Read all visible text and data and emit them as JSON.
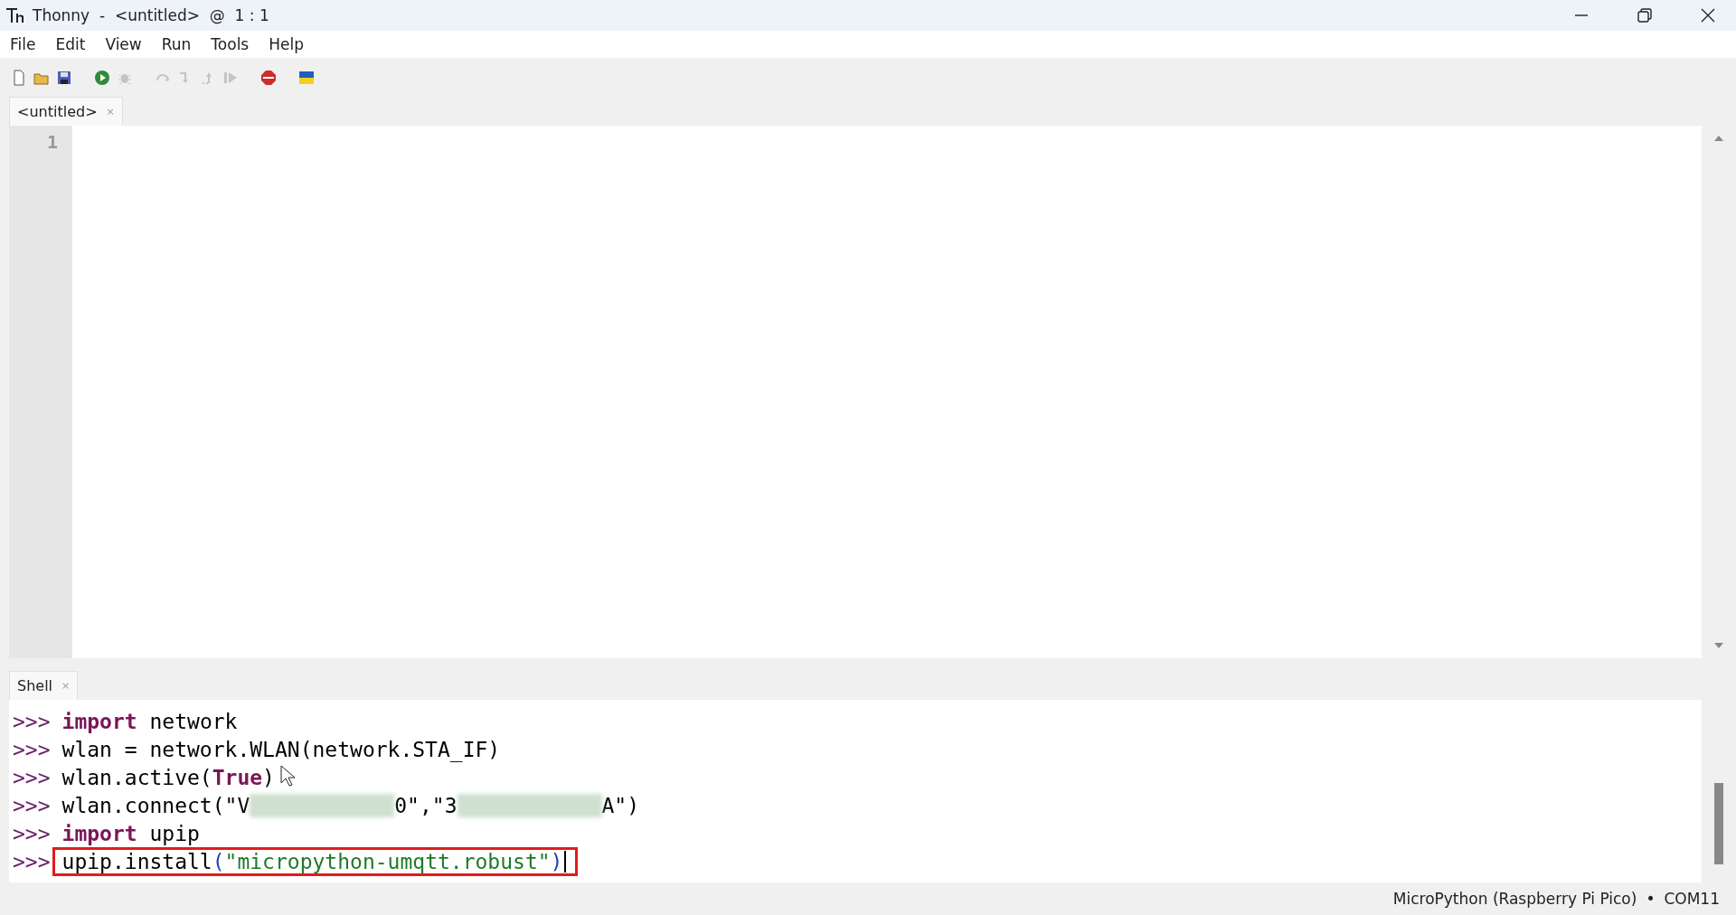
{
  "window": {
    "title": "Thonny  -  <untitled>  @  1 : 1"
  },
  "menu": [
    "File",
    "Edit",
    "View",
    "Run",
    "Tools",
    "Help"
  ],
  "toolbar": [
    {
      "kind": "new",
      "disabled": false
    },
    {
      "kind": "open",
      "disabled": false
    },
    {
      "kind": "save",
      "disabled": false
    },
    {
      "kind": "run",
      "disabled": false
    },
    {
      "kind": "debug",
      "disabled": true
    },
    {
      "kind": "step-over",
      "disabled": true
    },
    {
      "kind": "step-into",
      "disabled": true
    },
    {
      "kind": "step-out",
      "disabled": true
    },
    {
      "kind": "resume",
      "disabled": true
    },
    {
      "kind": "stop",
      "disabled": false
    },
    {
      "kind": "flag",
      "disabled": false
    }
  ],
  "editor_tabs": [
    {
      "label": "<untitled>",
      "close": "×",
      "selected": true
    }
  ],
  "editor": {
    "line_numbers": [
      "1"
    ]
  },
  "shell_tab": {
    "label": "Shell",
    "close": "×"
  },
  "shell": [
    {
      "highlighted": false,
      "cursor": false,
      "tokens": [
        {
          "kind": "prompt",
          "text": ">>>"
        },
        {
          "kind": "keyword",
          "text": "import"
        },
        {
          "kind": "text",
          "text": " network"
        }
      ]
    },
    {
      "highlighted": false,
      "cursor": false,
      "tokens": [
        {
          "kind": "prompt",
          "text": ">>>"
        },
        {
          "kind": "text",
          "text": "wlan = network.WLAN(network.STA_IF)"
        }
      ]
    },
    {
      "highlighted": false,
      "cursor": false,
      "tokens": [
        {
          "kind": "prompt",
          "text": ">>>"
        },
        {
          "kind": "text",
          "text": "wlan.active("
        },
        {
          "kind": "keyword",
          "text": "True"
        },
        {
          "kind": "text",
          "text": ")"
        }
      ]
    },
    {
      "highlighted": false,
      "cursor": false,
      "tokens": [
        {
          "kind": "prompt",
          "text": ">>>"
        },
        {
          "kind": "text",
          "text": "wlan.connect(\"V"
        },
        {
          "kind": "redacted"
        },
        {
          "kind": "text",
          "text": "0\",\"3"
        },
        {
          "kind": "redacted"
        },
        {
          "kind": "text",
          "text": "A\")"
        }
      ]
    },
    {
      "highlighted": false,
      "cursor": false,
      "tokens": [
        {
          "kind": "prompt",
          "text": ">>>"
        },
        {
          "kind": "keyword",
          "text": "import"
        },
        {
          "kind": "text",
          "text": " upip"
        }
      ]
    },
    {
      "highlighted": true,
      "cursor": true,
      "tokens": [
        {
          "kind": "prompt",
          "text": ">>>"
        },
        {
          "kind": "text",
          "text": "upip.install"
        },
        {
          "kind": "bracket",
          "text": "("
        },
        {
          "kind": "string",
          "text": "\"micropython-umqtt.robust\""
        },
        {
          "kind": "bracket",
          "text": ")"
        }
      ]
    }
  ],
  "status_bar": {
    "interpreter": "MicroPython (Raspberry Pi Pico)",
    "separator": "•",
    "port": "COM11"
  }
}
